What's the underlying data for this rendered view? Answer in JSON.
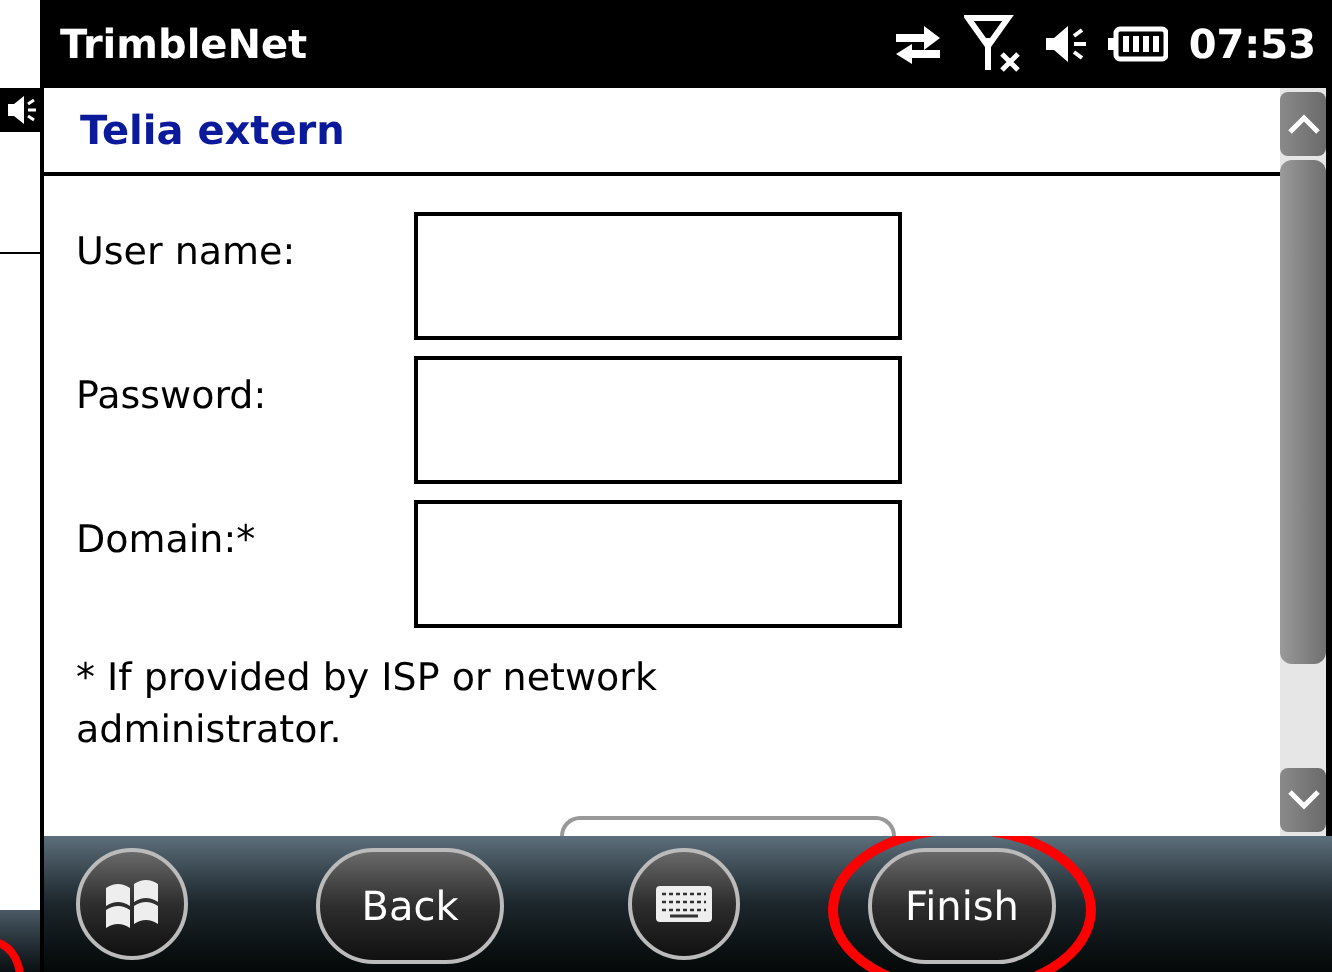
{
  "status_bar": {
    "app_title": "TrimbleNet",
    "time": "07:53"
  },
  "header": {
    "title": "Telia extern"
  },
  "fields": [
    {
      "label": "User name:"
    },
    {
      "label": "Password:"
    },
    {
      "label": "Domain:*"
    }
  ],
  "note": "* If provided by ISP or network administrator.",
  "softkeys": [
    {
      "kind": "start"
    },
    {
      "kind": "text",
      "label": "Back",
      "highlighted": false
    },
    {
      "kind": "keyboard"
    },
    {
      "kind": "text",
      "label": "Finish",
      "highlighted": true
    }
  ]
}
